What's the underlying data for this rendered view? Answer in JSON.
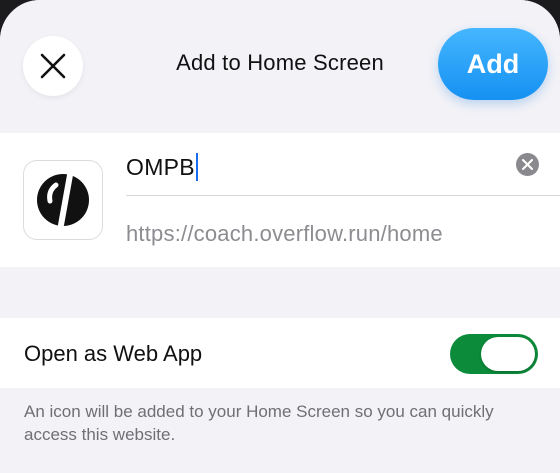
{
  "header": {
    "close_icon": "close-icon",
    "title": "Add to Home Screen",
    "add_label": "Add"
  },
  "app": {
    "icon": "omp-logo-icon",
    "name_value": "OMPB",
    "url": "https://coach.overflow.run/home",
    "clear_icon": "clear-x-icon"
  },
  "web_app": {
    "label": "Open as Web App",
    "enabled": true
  },
  "footer": {
    "text": "An icon will be added to your Home Screen so you can quickly access this website."
  },
  "colors": {
    "accent_blue": "#1591f2",
    "toggle_on": "#0c8c3b",
    "background": "#f2f2f7"
  }
}
